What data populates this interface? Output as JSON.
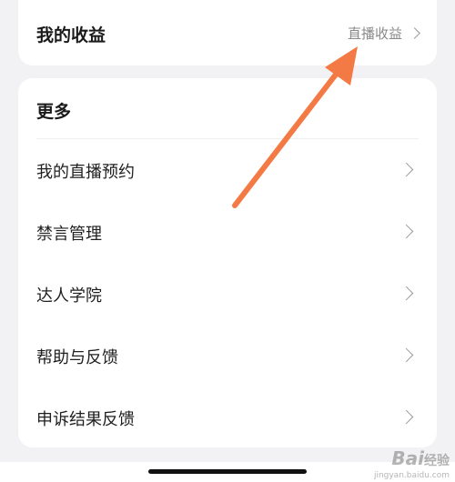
{
  "earnings": {
    "title": "我的收益",
    "link_label": "直播收益",
    "link_icon": "chevron-right-icon"
  },
  "more": {
    "title": "更多",
    "items": [
      {
        "label": "我的直播预约",
        "icon": "chevron-right-icon"
      },
      {
        "label": "禁言管理",
        "icon": "chevron-right-icon"
      },
      {
        "label": "达人学院",
        "icon": "chevron-right-icon"
      },
      {
        "label": "帮助与反馈",
        "icon": "chevron-right-icon"
      },
      {
        "label": "申诉结果反馈",
        "icon": "chevron-right-icon"
      }
    ]
  },
  "annotation": {
    "arrow_color": "#f47a45"
  },
  "watermark": {
    "brand": "Bai",
    "brand_suffix": "经验",
    "url": "jingyan.baidu.com"
  },
  "colors": {
    "background": "#f2f2f4",
    "card": "#ffffff"
  }
}
